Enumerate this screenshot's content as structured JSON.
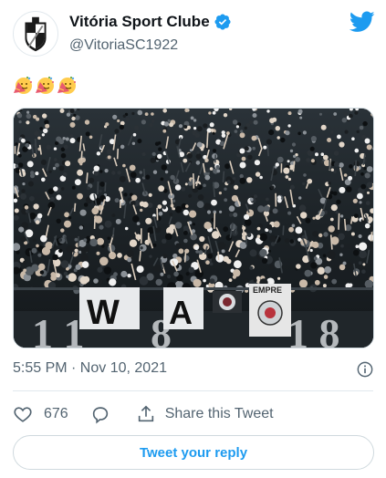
{
  "author": {
    "display_name": "Vitória Sport Clube",
    "handle": "@VitoriaSC1922",
    "verified": true,
    "avatar_icon": "club-crest-icon"
  },
  "tweet": {
    "emojis": [
      "partying-face-emoji",
      "partying-face-emoji",
      "partying-face-emoji"
    ],
    "media": {
      "type": "photo",
      "banner_letters": [
        "W",
        "A"
      ],
      "sign_text": "EMPRE"
    },
    "timestamp": "5:55 PM · Nov 10, 2021"
  },
  "actions": {
    "like_count": "676",
    "share_label": "Share this Tweet"
  },
  "reply_button_label": "Tweet your reply",
  "colors": {
    "brand_blue": "#1d9bf0",
    "text_secondary": "#536471",
    "border": "#cfd9de"
  }
}
